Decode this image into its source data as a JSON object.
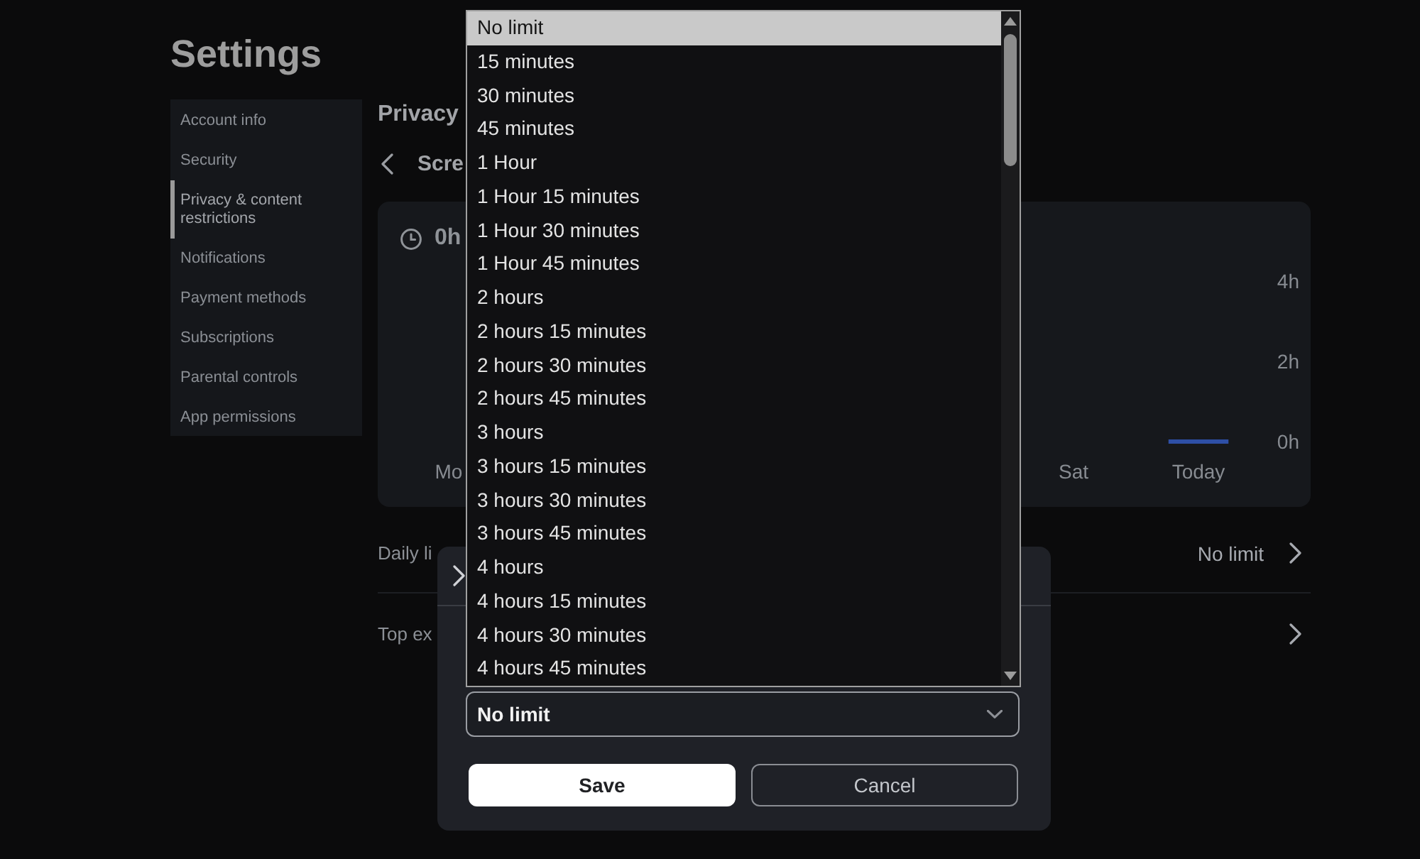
{
  "page": {
    "title": "Settings"
  },
  "sidebar": {
    "items": [
      {
        "label": "Account info",
        "selected": false
      },
      {
        "label": "Security",
        "selected": false
      },
      {
        "label": "Privacy & content restrictions",
        "selected": true
      },
      {
        "label": "Notifications",
        "selected": false
      },
      {
        "label": "Payment methods",
        "selected": false
      },
      {
        "label": "Subscriptions",
        "selected": false
      },
      {
        "label": "Parental controls",
        "selected": false
      },
      {
        "label": "App permissions",
        "selected": false
      }
    ]
  },
  "main": {
    "heading": "Privacy",
    "subheading": "Scre",
    "usage_card": {
      "total": "0h",
      "chart_data": {
        "type": "bar",
        "categories": [
          "Mo",
          null,
          null,
          null,
          null,
          "Sat",
          "Today"
        ],
        "series": [
          {
            "color": "#2e4fa6",
            "values": [
              null,
              null,
              null,
              null,
              null,
              null,
              0
            ]
          }
        ],
        "ylim": [
          0,
          4
        ],
        "yticks": [
          {
            "value": 0,
            "label": "0h"
          },
          {
            "value": 2,
            "label": "2h"
          },
          {
            "value": 4,
            "label": "4h"
          }
        ]
      }
    },
    "rows": [
      {
        "label": "Daily li",
        "value": "No limit"
      },
      {
        "label": "Top ex"
      }
    ]
  },
  "dialog": {
    "select": {
      "value": "No limit",
      "expanded": true,
      "options": [
        {
          "label": "No limit",
          "selected": true
        },
        {
          "label": "15 minutes",
          "selected": false
        },
        {
          "label": "30 minutes",
          "selected": false
        },
        {
          "label": "45 minutes",
          "selected": false
        },
        {
          "label": "1 Hour",
          "selected": false
        },
        {
          "label": "1 Hour 15 minutes",
          "selected": false
        },
        {
          "label": "1 Hour 30 minutes",
          "selected": false
        },
        {
          "label": "1 Hour 45 minutes",
          "selected": false
        },
        {
          "label": "2 hours",
          "selected": false
        },
        {
          "label": "2 hours 15 minutes",
          "selected": false
        },
        {
          "label": "2 hours 30 minutes",
          "selected": false
        },
        {
          "label": "2 hours 45 minutes",
          "selected": false
        },
        {
          "label": "3 hours",
          "selected": false
        },
        {
          "label": "3 hours 15 minutes",
          "selected": false
        },
        {
          "label": "3 hours 30 minutes",
          "selected": false
        },
        {
          "label": "3 hours 45 minutes",
          "selected": false
        },
        {
          "label": "4 hours",
          "selected": false
        },
        {
          "label": "4 hours 15 minutes",
          "selected": false
        },
        {
          "label": "4 hours 30 minutes",
          "selected": false
        },
        {
          "label": "4 hours 45 minutes",
          "selected": false
        }
      ]
    },
    "buttons": [
      {
        "label": "Save",
        "kind": "primary"
      },
      {
        "label": "Cancel",
        "kind": "secondary"
      }
    ]
  }
}
